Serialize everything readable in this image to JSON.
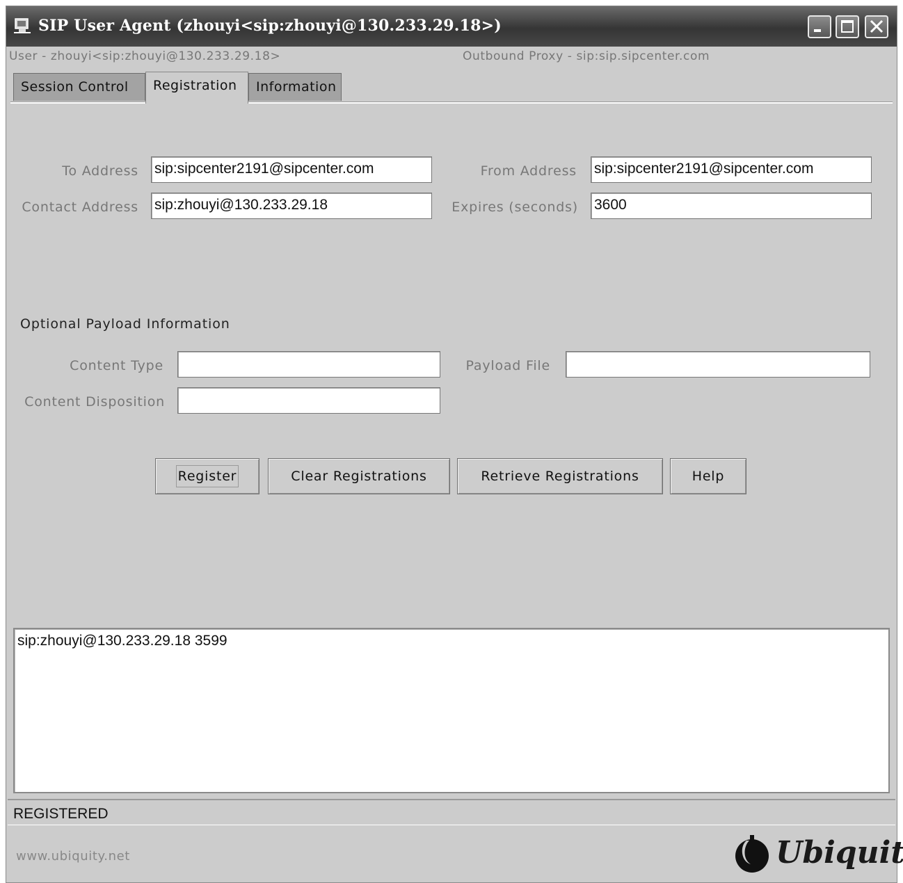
{
  "window": {
    "title": "SIP User Agent (zhouyi<sip:zhouyi@130.233.29.18>)",
    "icon": "sip-app-icon"
  },
  "header": {
    "user": "User - zhouyi<sip:zhouyi@130.233.29.18>",
    "proxy": "Outbound Proxy - sip:sip.sipcenter.com"
  },
  "tabs": [
    {
      "label": "Session Control",
      "active": false
    },
    {
      "label": "Registration",
      "active": true
    },
    {
      "label": "Information",
      "active": false
    }
  ],
  "registration": {
    "to_label": "To Address",
    "to_value": "sip:sipcenter2191@sipcenter.com",
    "from_label": "From Address",
    "from_value": "sip:sipcenter2191@sipcenter.com",
    "contact_label": "Contact Address",
    "contact_value": "sip:zhouyi@130.233.29.18",
    "expires_label": "Expires (seconds)",
    "expires_value": "3600"
  },
  "payload": {
    "section_title": "Optional Payload Information",
    "content_type_label": "Content Type",
    "content_type_value": "",
    "payload_file_label": "Payload File",
    "payload_file_value": "",
    "content_disposition_label": "Content Disposition",
    "content_disposition_value": ""
  },
  "buttons": {
    "register": "Register",
    "clear": "Clear Registrations",
    "retrieve": "Retrieve Registrations",
    "help": "Help"
  },
  "results": {
    "text": "sip:zhouyi@130.233.29.18 3599"
  },
  "status": {
    "text": "REGISTERED"
  },
  "footer": {
    "website": "www.ubiquity.net",
    "logo_text": "Ubiquity"
  }
}
